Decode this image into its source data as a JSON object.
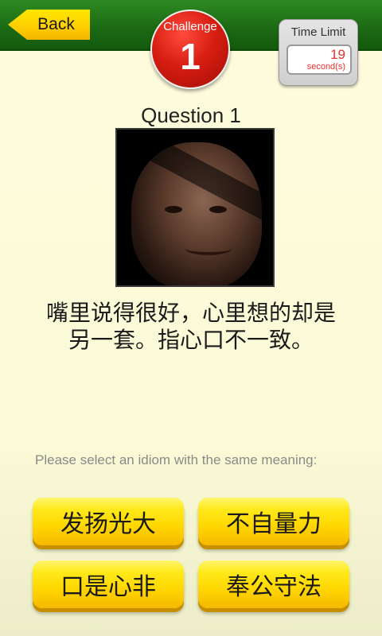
{
  "header": {
    "back_label": "Back",
    "challenge_label": "Challenge",
    "challenge_number": "1",
    "time_limit_label": "Time Limit",
    "time_value": "19",
    "time_unit": "second(s)"
  },
  "question": {
    "title": "Question 1",
    "image_icon": "face-portrait-image",
    "meaning_line1": "嘴里说得很好，心里想的却是",
    "meaning_line2": "另一套。指心口不一致。",
    "prompt": "Please select an idiom with the same meaning:"
  },
  "answers": [
    {
      "label": "发扬光大"
    },
    {
      "label": "不自量力"
    },
    {
      "label": "口是心非"
    },
    {
      "label": "奉公守法"
    }
  ],
  "colors": {
    "header_green": "#1c6b14",
    "button_yellow": "#ffd600",
    "challenge_red": "#d81e12",
    "timer_red": "#e8322a"
  }
}
